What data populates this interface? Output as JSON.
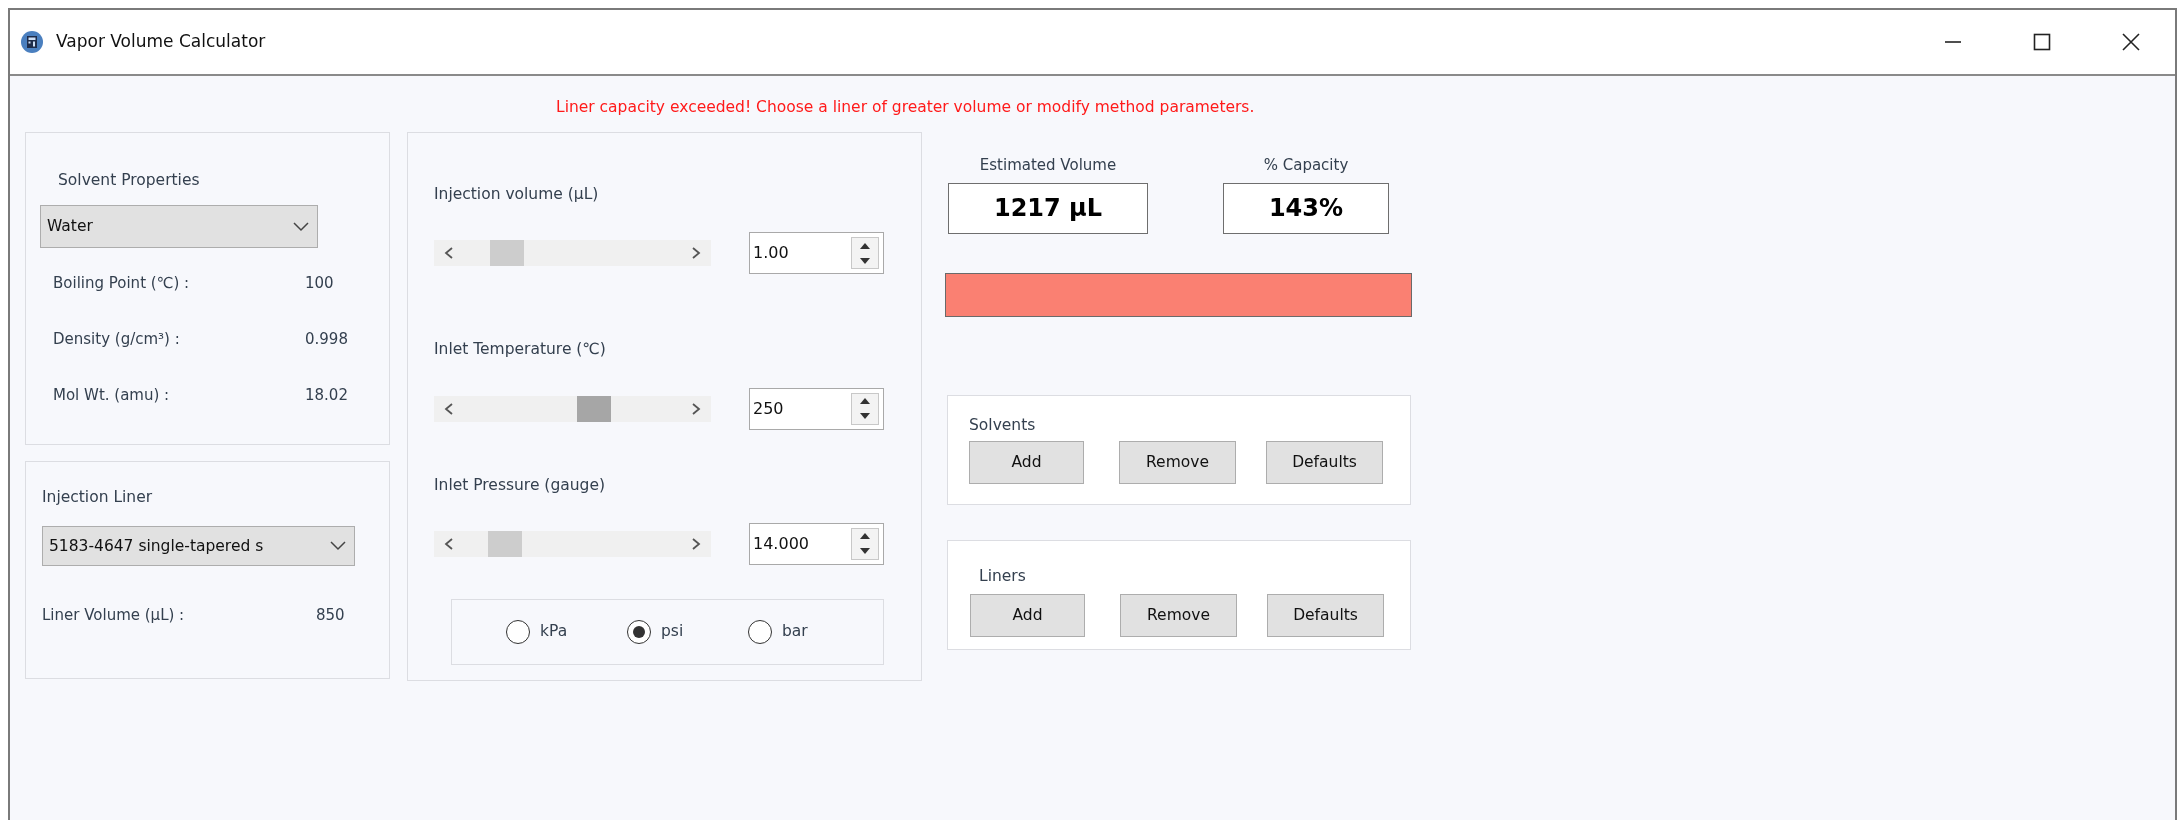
{
  "window": {
    "title": "Vapor Volume Calculator"
  },
  "warning": "Liner capacity exceeded! Choose a liner of greater volume or modify method parameters.",
  "solvent_properties": {
    "title": "Solvent Properties",
    "dropdown": {
      "value": "Water"
    },
    "properties": [
      {
        "label": "Boiling Point (℃) :",
        "value": "100"
      },
      {
        "label": "Density (g/cm³) :",
        "value": "0.998"
      },
      {
        "label": "Mol Wt. (amu) :",
        "value": "18.02"
      }
    ]
  },
  "injection_liner": {
    "title": "Injection Liner",
    "dropdown": {
      "value": "5183-4647 single-tapered s"
    },
    "properties": [
      {
        "label": "Liner Volume (µL) :",
        "value": "850"
      }
    ]
  },
  "parameters": [
    {
      "label": "Injection volume (µL)",
      "value": "1.00",
      "active": false
    },
    {
      "label": "Inlet Temperature (℃)",
      "value": "250",
      "active": true
    },
    {
      "label": "Inlet Pressure (gauge)",
      "value": "14.000",
      "active": false
    }
  ],
  "units": [
    {
      "label": "kPa",
      "selected": false
    },
    {
      "label": "psi",
      "selected": true
    },
    {
      "label": "bar",
      "selected": false
    }
  ],
  "results": [
    {
      "label": "Estimated Volume",
      "value": "1217 µL"
    },
    {
      "label": "% Capacity",
      "value": "143%"
    }
  ],
  "capacity_bar": {
    "level": 1
  },
  "managers": [
    {
      "title": "Solvents",
      "buttons": [
        "Add",
        "Remove",
        "Defaults"
      ]
    },
    {
      "title": "Liners",
      "buttons": [
        "Add",
        "Remove",
        "Defaults"
      ]
    }
  ]
}
